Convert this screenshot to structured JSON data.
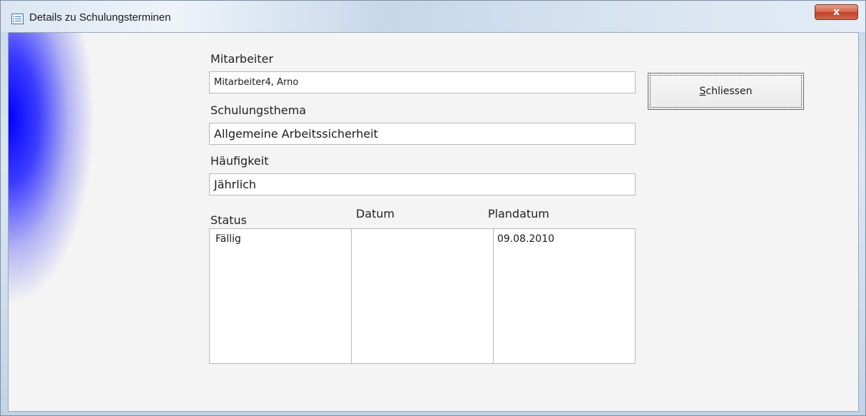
{
  "window": {
    "title": "Details zu Schulungsterminen",
    "close_symbol": "x",
    "icon": "form-icon"
  },
  "form": {
    "mitarbeiter_label": "Mitarbeiter",
    "mitarbeiter_value": "Mitarbeiter4, Arno",
    "thema_label": "Schulungsthema",
    "thema_value": "Allgemeine Arbeitssicherheit",
    "haeufigkeit_label": "Häufigkeit",
    "haeufigkeit_value": "Jährlich",
    "status_label": "Status",
    "status_value": "Fällig",
    "datum_label": "Datum",
    "datum_value": "",
    "plandatum_label": "Plandatum",
    "plandatum_value": "09.08.2010"
  },
  "buttons": {
    "close_mnemonic": "S",
    "close_rest": "chliessen"
  },
  "colors": {
    "accent_blue": "#0000ff",
    "close_red": "#c0412a"
  }
}
